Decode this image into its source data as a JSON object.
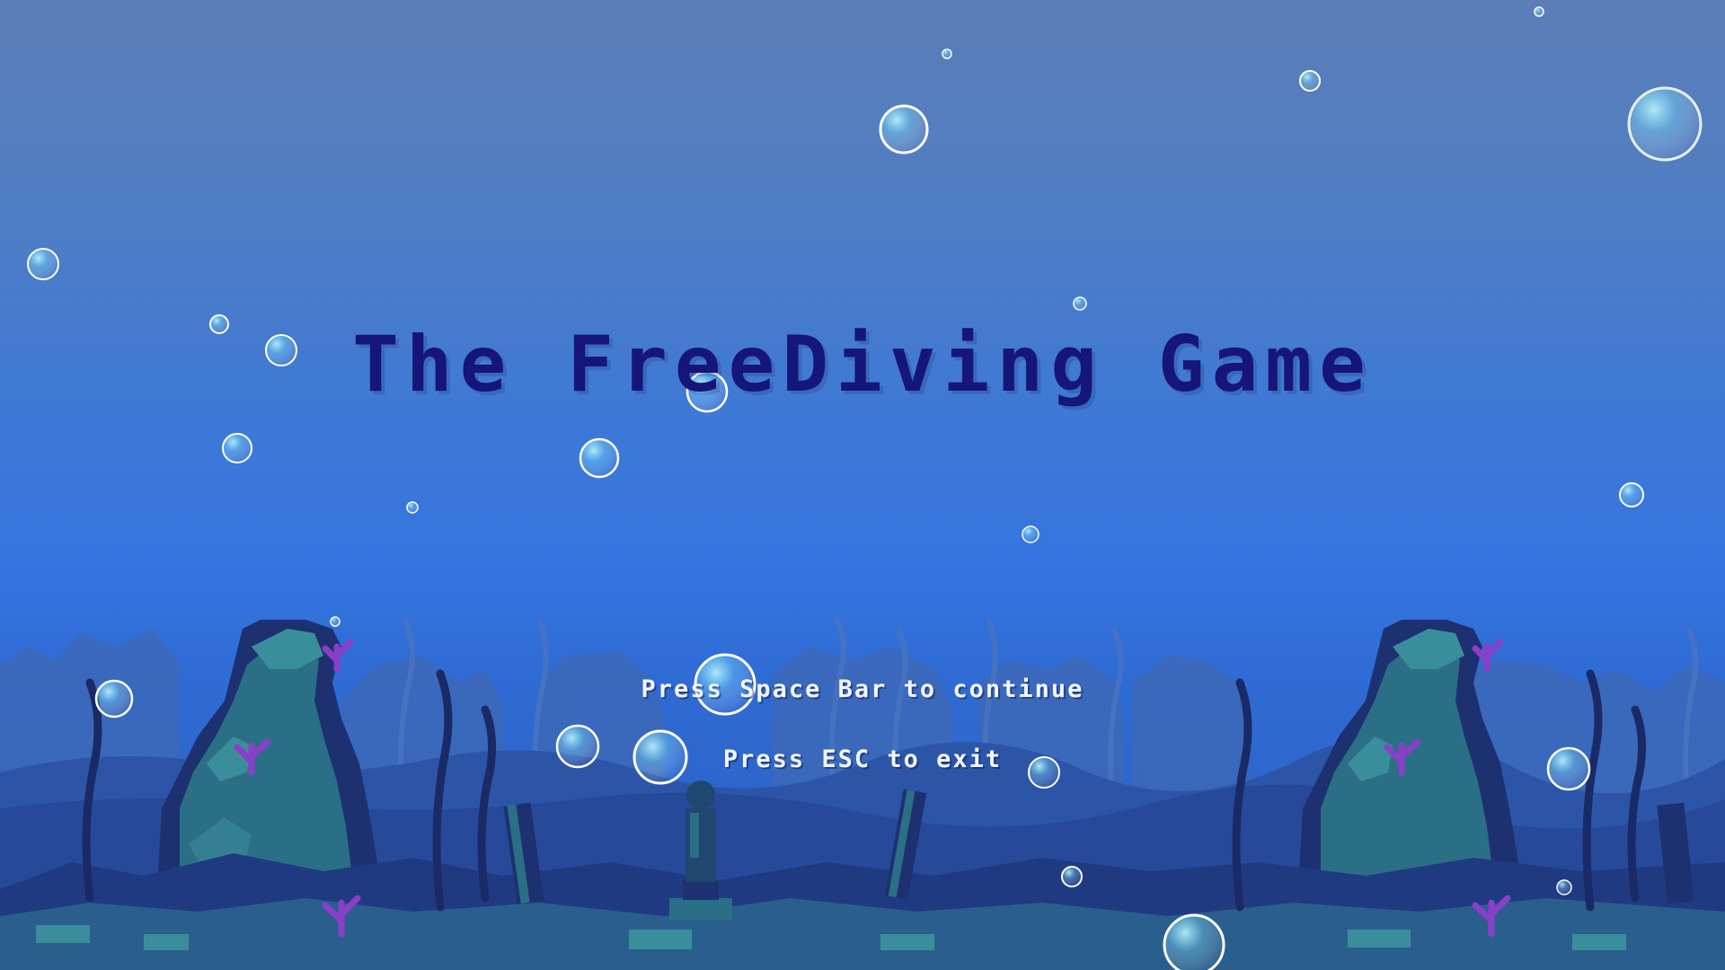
{
  "game": {
    "title": "The FreeDiving Game",
    "prompts": {
      "continue": "Press Space Bar to continue",
      "exit": "Press ESC to exit"
    }
  },
  "palette": {
    "sky_top": "#5b7eb6",
    "water_mid": "#3575e0",
    "title_color": "#16157a",
    "prompt_color": "#f2f6ff",
    "rock_dark": "#1d3170",
    "rock_teal": "#2b6f86",
    "kelp_dark": "#1a2a66",
    "coral_purple": "#8a3fc8",
    "bubble_rim": "#ffffff",
    "bubble_fill": "#7fe3ff"
  },
  "icons": {
    "bubble": "bubble-icon",
    "statue": "statue-icon",
    "pillar": "pillar-icon",
    "kelp": "kelp-icon",
    "coral": "coral-icon"
  }
}
